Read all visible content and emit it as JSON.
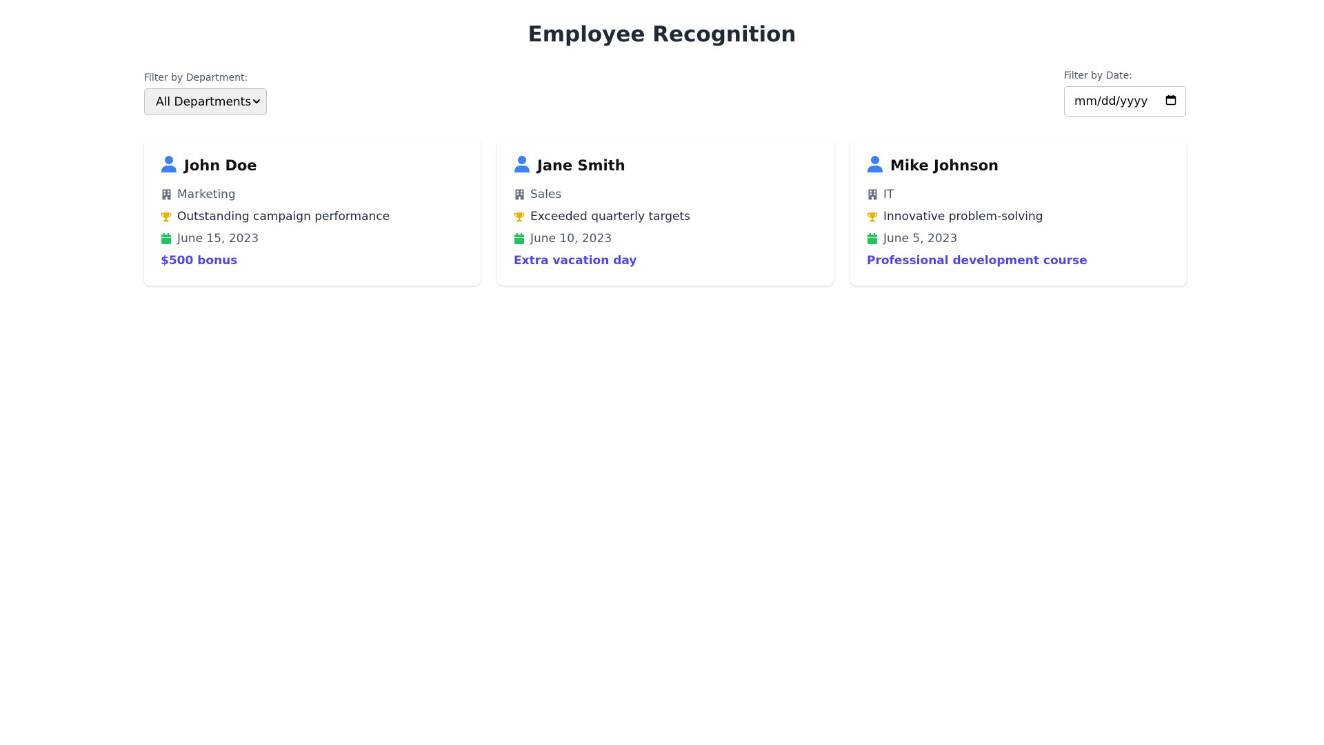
{
  "page": {
    "title": "Employee Recognition"
  },
  "filters": {
    "department": {
      "label": "Filter by Department:",
      "selected": "All Departments"
    },
    "date": {
      "label": "Filter by Date:",
      "placeholder": "mm/dd/yyyy"
    }
  },
  "colors": {
    "user_icon": "#3b82f6",
    "building_icon": "#6b7280",
    "trophy_icon": "#eab308",
    "calendar_icon": "#22c55e",
    "reward_text": "#4f46e5"
  },
  "icons": {
    "user": "user-icon",
    "department": "building-icon",
    "reason": "trophy-icon",
    "date": "calendar-icon"
  },
  "employees": [
    {
      "name": "John Doe",
      "department": "Marketing",
      "reason": "Outstanding campaign performance",
      "date": "June 15, 2023",
      "reward": "$500 bonus"
    },
    {
      "name": "Jane Smith",
      "department": "Sales",
      "reason": "Exceeded quarterly targets",
      "date": "June 10, 2023",
      "reward": "Extra vacation day"
    },
    {
      "name": "Mike Johnson",
      "department": "IT",
      "reason": "Innovative problem-solving",
      "date": "June 5, 2023",
      "reward": "Professional development course"
    }
  ]
}
